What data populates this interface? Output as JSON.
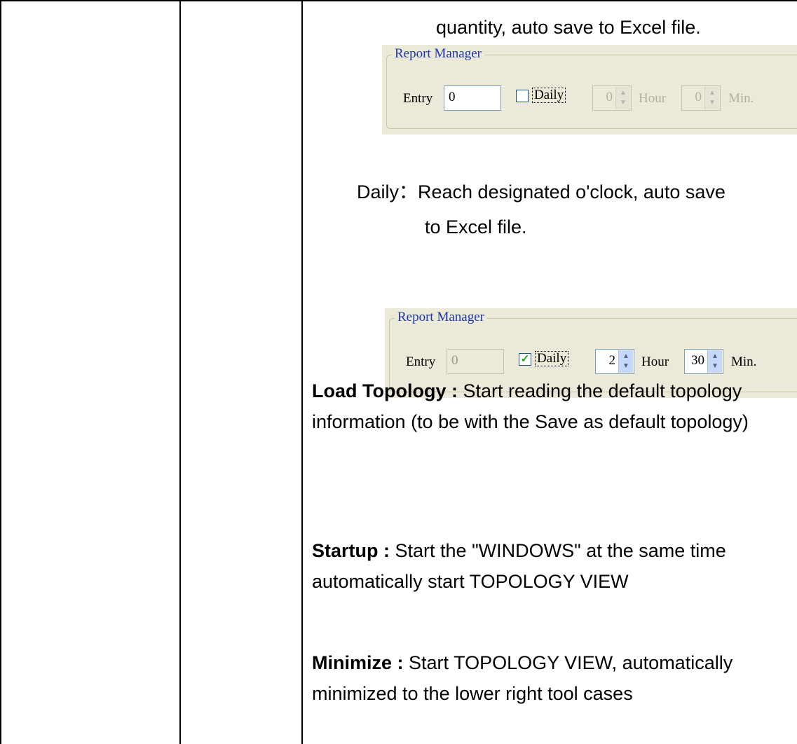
{
  "intro_line": "quantity, auto save to Excel file.",
  "panel_entry": {
    "title": "Report Manager",
    "entry_label": "Entry",
    "entry_value": "0",
    "daily_label": "Daily",
    "daily_checked": false,
    "hour_value": "0",
    "hour_label": "Hour",
    "min_value": "0",
    "min_label": "Min."
  },
  "daily_desc": {
    "line1": "Daily：Reach designated o'clock, auto save",
    "line2": "to Excel file."
  },
  "panel_daily": {
    "title": "Report Manager",
    "entry_label": "Entry",
    "entry_value": "0",
    "daily_label": "Daily",
    "daily_checked": true,
    "hour_value": "2",
    "hour_label": "Hour",
    "min_value": "30",
    "min_label": "Min."
  },
  "load_topology": {
    "term": "Load Topology :",
    "text": "Start reading the default topology information (to be with the Save as default topology)"
  },
  "startup": {
    "term": "Startup :",
    "text": "Start the \"WINDOWS\" at the same time automatically start TOPOLOGY VIEW"
  },
  "minimize": {
    "term": "Minimize :",
    "text": "Start TOPOLOGY VIEW, automatically minimized to the lower right tool cases"
  }
}
